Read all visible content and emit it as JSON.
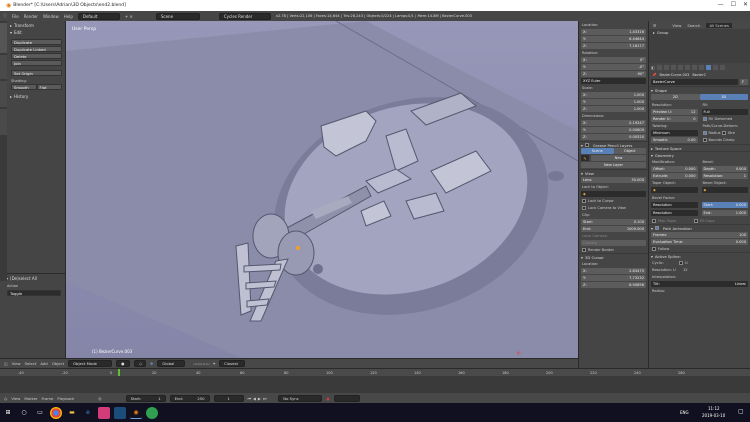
{
  "window": {
    "title": "Blender* [C:\\Users\\Adrian\\3D Objects\\end2.blend]",
    "min": "—",
    "max": "☐",
    "close": "✕"
  },
  "infobar": {
    "menus": [
      "File",
      "Render",
      "Window",
      "Help"
    ],
    "layout": "Default",
    "scene": "Scene",
    "engine": "Cycles Render",
    "stats": "v2.78 | Verts:22,106 | Faces:14,644 | Tris:26,243 | Objects:0/224 | Lamps:0/1 | Mem:14.8M | BezierCurve.003"
  },
  "toolshelf": {
    "transform": "Transform",
    "edit": "Edit",
    "buttons": [
      "Duplicate",
      "Duplicate Linked",
      "Delete",
      "Join"
    ],
    "set_origin": "Set Origin",
    "shading": "Shading:",
    "smooth": "Smooth",
    "flat": "Flat",
    "history": "History",
    "op_title": "(De)select All",
    "action_label": "Action",
    "action_value": "Toggle"
  },
  "viewport": {
    "label": "User Persp",
    "object_label": "(1) BezierCurve.003"
  },
  "vpfooter": {
    "items": [
      "View",
      "Select",
      "Add",
      "Object"
    ],
    "mode": "Object Mode",
    "pivot": "Global",
    "layers": "Closest"
  },
  "props": {
    "location": "Location:",
    "loc": [
      {
        "a": "X:",
        "v": "1.43316"
      },
      {
        "a": "Y:",
        "v": "6.44644"
      },
      {
        "a": "Z:",
        "v": "7.16177"
      }
    ],
    "rotation": "Rotation:",
    "rot": [
      {
        "a": "X:",
        "v": "0°"
      },
      {
        "a": "Y:",
        "v": "-0°"
      },
      {
        "a": "Z:",
        "v": "-90°"
      }
    ],
    "rotmode": "XYZ Euler",
    "scale": "Scale:",
    "scl": [
      {
        "a": "X:",
        "v": "1.000"
      },
      {
        "a": "Y:",
        "v": "1.000"
      },
      {
        "a": "Z:",
        "v": "1.000"
      }
    ],
    "dimensions": "Dimensions:",
    "dim": [
      {
        "a": "X:",
        "v": "0.19247"
      },
      {
        "a": "Y:",
        "v": "0.00600"
      },
      {
        "a": "Z:",
        "v": "0.00520"
      }
    ],
    "gpencil": "Grease Pencil Layers",
    "scene_tab": "Scene",
    "object_tab": "Object",
    "new": "New",
    "new_layer": "New Layer",
    "view": "View",
    "lens_label": "Lens:",
    "lens": "35.000",
    "lock_obj": "Lock to Object:",
    "lock_cursor": "Lock to Cursor",
    "lock_camera": "Lock Camera to View",
    "clip": "Clip:",
    "clip_start_l": "Start:",
    "clip_start": "0.100",
    "clip_end_l": "End:",
    "clip_end": "1000.000",
    "local_camera": "Local Camera:",
    "camera": "Camera",
    "render_border": "Render Border",
    "cursor3d": "3D Cursor",
    "cursor_loc": "Location:",
    "cur": [
      {
        "a": "X:",
        "v": "2.83475"
      },
      {
        "a": "Y:",
        "v": "7.73232"
      },
      {
        "a": "Z:",
        "v": "6.90856"
      }
    ]
  },
  "outliner": {
    "tabs": [
      "View",
      "Search",
      "All Scenes"
    ],
    "row": "Group"
  },
  "curveprops": {
    "breadcrumb": "BezierCurve.003",
    "breadcrumb2": "BezierC",
    "name": "BezierCurve",
    "f": "F",
    "shape": "Shape",
    "two_d": "2D",
    "three_d": "3D",
    "resolution": "Resolution:",
    "fill": "Fill:",
    "preview_u": "Preview U:",
    "preview_u_v": "12",
    "render_u": "Render U:",
    "render_u_v": "0",
    "fill_v": "Full",
    "fill_deformed": "Fill Deformed",
    "twisting": "Twisting:",
    "path_curve": "Path/Curve-Deform:",
    "twist_v": "Minimum",
    "radius": "Radius",
    "stretch": "Stre",
    "smooth": "Smooth:",
    "smooth_v": "0.00",
    "bounds_clamp": "Bounds Clamp",
    "texture_space": "Texture Space",
    "geometry": "Geometry",
    "modification": "Modification:",
    "bevel": "Bevel:",
    "offset": "Offset:",
    "offset_v": "0.000",
    "depth": "Depth:",
    "depth_v": "0.000",
    "extrude": "Extrude:",
    "extrude_v": "0.000",
    "bev_res": "Resolution:",
    "bev_res_v": "1",
    "taper": "Taper Object:",
    "bevel_obj": "Bevel Object:",
    "bevel_factor": "Bevel Factor:",
    "bf_res": "Resolution",
    "bf_start": "Start:",
    "bf_start_v": "0.000",
    "bf_res2": "Resolution",
    "bf_end": "End:",
    "bf_end_v": "1.000",
    "map_taper": "Map Taper",
    "fill_caps": "Fill Caps",
    "path_anim": "Path Animation",
    "frames": "Frames:",
    "frames_v": "100",
    "eval_time": "Evaluation Time:",
    "eval_v": "0.000",
    "follow": "Follow",
    "active_spline": "Active Spline:",
    "cyclic": "Cyclic:",
    "u": "U",
    "resolution2": "Resolution:",
    "res2_v": "12",
    "interpolation": "Interpolation:",
    "tilt": "Tilt:",
    "tilt_v": "Linear",
    "radius2": "Radius:"
  },
  "timeline": {
    "ticks": [
      "-40",
      "-20",
      "0",
      "20",
      "40",
      "60",
      "80",
      "100",
      "120",
      "140",
      "160",
      "180",
      "200",
      "220",
      "240",
      "260"
    ],
    "menus": [
      "View",
      "Marker",
      "Frame",
      "Playback"
    ],
    "start_l": "Start:",
    "start": "1",
    "end_l": "End:",
    "end": "250",
    "current": "1",
    "sync": "No Sync"
  },
  "taskbar": {
    "lang": "ENG",
    "time": "11:12",
    "date": "2019-03-10"
  },
  "colors": {
    "accent": "#5a80b8",
    "viewport_bg": "#9090b4",
    "object": "#9fa1b8",
    "frame_marker": "#60c030"
  }
}
